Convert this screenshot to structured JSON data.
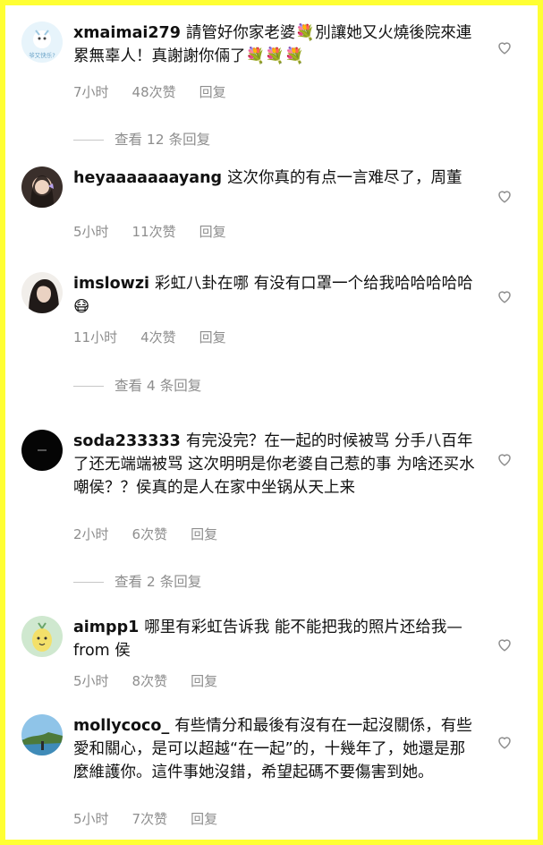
{
  "comments": [
    {
      "username": "xmaimai279",
      "text": "請管好你家老婆💐別讓她又火燒後院來連累無辜人！真謝謝你倆了💐💐💐",
      "time": "7小时",
      "likes": "48次赞",
      "reply": "回复",
      "avatar_text": "爷又快乐?",
      "view_replies": "查看 12 条回复"
    },
    {
      "username": "heyaaaaaaayang",
      "text": "这次你真的有点一言难尽了，周董",
      "time": "5小时",
      "likes": "11次赞",
      "reply": "回复"
    },
    {
      "username": "imslowzi",
      "text": "彩虹八卦在哪 有没有口罩一个给我哈哈哈哈哈😷",
      "time": "11小时",
      "likes": "4次赞",
      "reply": "回复",
      "view_replies": "查看 4 条回复"
    },
    {
      "username": "soda233333",
      "text": "有完没完？在一起的时候被骂 分手八百年了还无端端被骂 这次明明是你老婆自己惹的事 为啥还买水嘲侯？？侯真的是人在家中坐锅从天上来",
      "time": "2小时",
      "likes": "6次赞",
      "reply": "回复",
      "view_replies": "查看 2 条回复"
    },
    {
      "username": "aimpp1",
      "text": "哪里有彩虹告诉我 能不能把我的照片还给我—from 侯",
      "time": "5小时",
      "likes": "8次赞",
      "reply": "回复"
    },
    {
      "username": "mollycoco_",
      "text": "有些情分和最後有沒有在一起沒關係，有些愛和關心，是可以超越“在一起”的，十幾年了，她還是那麼維護你。這件事她沒錯，希望起碼不要傷害到她。",
      "time": "5小时",
      "likes": "7次赞",
      "reply": "回复"
    }
  ],
  "colors": {
    "frame": "#ffff33",
    "meta": "#8e8e8e",
    "text": "#111111"
  },
  "icons": {
    "like": "heart-outline-icon",
    "bouquet": "bouquet-emoji",
    "mask": "mask-face-emoji"
  }
}
